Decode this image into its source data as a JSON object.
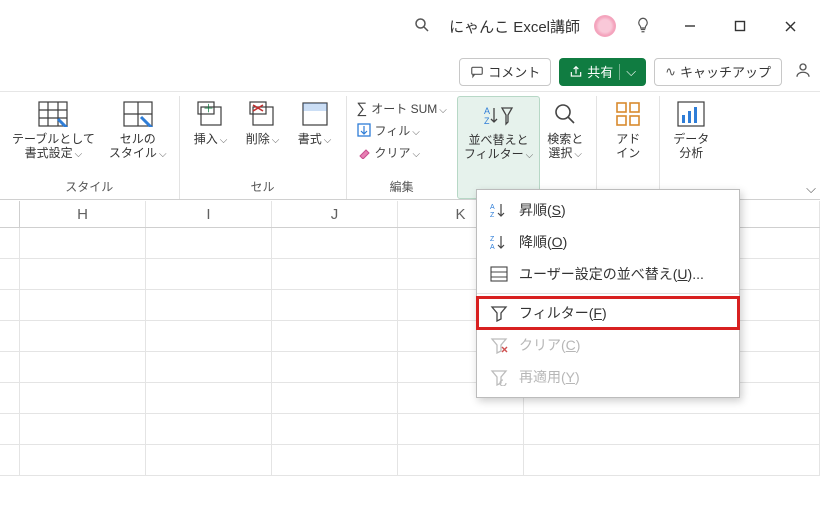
{
  "titlebar": {
    "title": "にゃんこ Excel講師"
  },
  "row2": {
    "comment": "コメント",
    "share": "共有",
    "catchup": "キャッチアップ"
  },
  "ribbon": {
    "styles": {
      "formatAsTable": "テーブルとして\n書式設定",
      "cellStyles": "セルの\nスタイル",
      "label": "スタイル"
    },
    "cells": {
      "insert": "挿入",
      "delete": "削除",
      "format": "書式",
      "label": "セル"
    },
    "editing": {
      "autosum": "オート SUM",
      "fill": "フィル",
      "clear": "クリア",
      "label": "編集",
      "sortFilter": "並べ替えと\nフィルター",
      "findSelect": "検索と\n選択"
    },
    "addins": {
      "label": "アド\nイン"
    },
    "analysis": {
      "label": "データ\n分析"
    }
  },
  "menu": {
    "asc": "昇順",
    "ascKey": "S",
    "desc": "降順",
    "descKey": "O",
    "custom": "ユーザー設定の並べ替え",
    "customKey": "U",
    "filter": "フィルター",
    "filterKey": "F",
    "clear": "クリア",
    "clearKey": "C",
    "reapply": "再適用",
    "reapplyKey": "Y"
  },
  "columns": [
    "H",
    "I",
    "J",
    "K"
  ]
}
